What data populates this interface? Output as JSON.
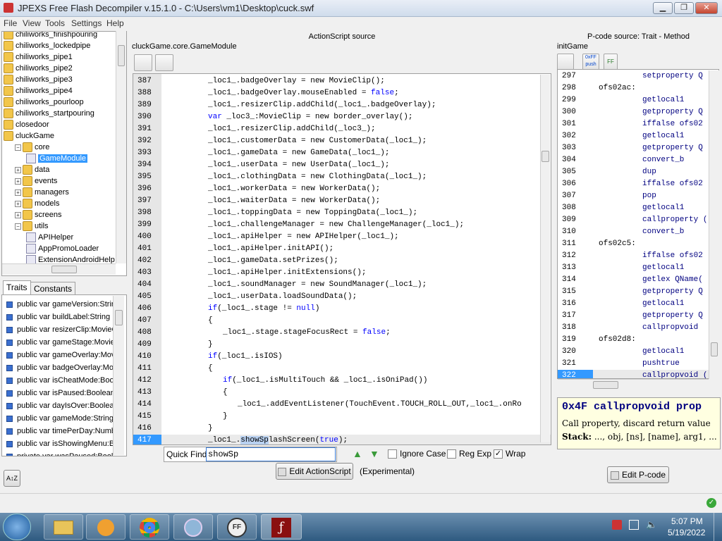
{
  "window": {
    "title": "JPEXS Free Flash Decompiler v.15.1.0 - C:\\Users\\vm1\\Desktop\\cuck.swf",
    "minimize": "▁",
    "maximize": "❐",
    "close": "✕"
  },
  "menu": [
    "File",
    "View",
    "Tools",
    "Settings",
    "Help"
  ],
  "tree": {
    "items": [
      {
        "label": "chiliworks_finishpouring",
        "type": "folder",
        "indent": 0
      },
      {
        "label": "chiliworks_lockedpipe",
        "type": "folder",
        "indent": 0
      },
      {
        "label": "chiliworks_pipe1",
        "type": "folder",
        "indent": 0
      },
      {
        "label": "chiliworks_pipe2",
        "type": "folder",
        "indent": 0
      },
      {
        "label": "chiliworks_pipe3",
        "type": "folder",
        "indent": 0
      },
      {
        "label": "chiliworks_pipe4",
        "type": "folder",
        "indent": 0
      },
      {
        "label": "chiliworks_pourloop",
        "type": "folder",
        "indent": 0
      },
      {
        "label": "chiliworks_startpouring",
        "type": "folder",
        "indent": 0
      },
      {
        "label": "closedoor",
        "type": "folder",
        "indent": 0
      },
      {
        "label": "cluckGame",
        "type": "folder",
        "indent": 0
      },
      {
        "label": "core",
        "type": "folder",
        "indent": 1,
        "toggle": "−"
      },
      {
        "label": "GameModule",
        "type": "class",
        "indent": 2,
        "selected": true
      },
      {
        "label": "data",
        "type": "folder",
        "indent": 1,
        "toggle": "+"
      },
      {
        "label": "events",
        "type": "folder",
        "indent": 1,
        "toggle": "+"
      },
      {
        "label": "managers",
        "type": "folder",
        "indent": 1,
        "toggle": "+"
      },
      {
        "label": "models",
        "type": "folder",
        "indent": 1,
        "toggle": "+"
      },
      {
        "label": "screens",
        "type": "folder",
        "indent": 1,
        "toggle": "+"
      },
      {
        "label": "utils",
        "type": "folder",
        "indent": 1,
        "toggle": "−"
      },
      {
        "label": "APIHelper",
        "type": "class",
        "indent": 2
      },
      {
        "label": "AppPromoLoader",
        "type": "class",
        "indent": 2
      },
      {
        "label": "ExtensionAndroidHelp",
        "type": "class",
        "indent": 2
      }
    ]
  },
  "traits_tabs": [
    "Traits",
    "Constants"
  ],
  "traits": [
    "public var gameVersion:Strin",
    "public var buildLabel:String",
    "public var resizerClip:MovieC",
    "public var gameStage:Movie",
    "public var gameOverlay:Mov",
    "public var badgeOverlay:Mo",
    "public var isCheatMode:Boo",
    "public var isPaused:Boolean",
    "public var dayIsOver:Boolea",
    "public var gameMode:String",
    "public var timePerDay:Numb",
    "public var isShowingMenu:B",
    "private var wasPaused:Bool"
  ],
  "sort_button": "A↕Z",
  "as_panel": {
    "header": "ActionScript source",
    "path": "cluckGame.core.GameModule",
    "lines": [
      {
        "n": "387",
        "i": 0,
        "parts": [
          [
            "_loc1_.badgeOverlay = new MovieClip();",
            ""
          ]
        ]
      },
      {
        "n": "388",
        "i": 0,
        "parts": [
          [
            "_loc1_.badgeOverlay.mouseEnabled = ",
            ""
          ],
          [
            "false",
            "kw"
          ],
          [
            ";",
            ""
          ]
        ]
      },
      {
        "n": "389",
        "i": 0,
        "parts": [
          [
            "_loc1_.resizerClip.addChild(_loc1_.badgeOverlay);",
            ""
          ]
        ]
      },
      {
        "n": "390",
        "i": 0,
        "parts": [
          [
            "var",
            "kw"
          ],
          [
            " _loc3_:MovieClip = new border_overlay();",
            ""
          ]
        ]
      },
      {
        "n": "391",
        "i": 0,
        "parts": [
          [
            "_loc1_.resizerClip.addChild(_loc3_);",
            ""
          ]
        ]
      },
      {
        "n": "392",
        "i": 0,
        "parts": [
          [
            "_loc1_.customerData = new CustomerData(_loc1_);",
            ""
          ]
        ]
      },
      {
        "n": "393",
        "i": 0,
        "parts": [
          [
            "_loc1_.gameData = new GameData(_loc1_);",
            ""
          ]
        ]
      },
      {
        "n": "394",
        "i": 0,
        "parts": [
          [
            "_loc1_.userData = new UserData(_loc1_);",
            ""
          ]
        ]
      },
      {
        "n": "395",
        "i": 0,
        "parts": [
          [
            "_loc1_.clothingData = new ClothingData(_loc1_);",
            ""
          ]
        ]
      },
      {
        "n": "396",
        "i": 0,
        "parts": [
          [
            "_loc1_.workerData = new WorkerData();",
            ""
          ]
        ]
      },
      {
        "n": "397",
        "i": 0,
        "parts": [
          [
            "_loc1_.waiterData = new WorkerData();",
            ""
          ]
        ]
      },
      {
        "n": "398",
        "i": 0,
        "parts": [
          [
            "_loc1_.toppingData = new ToppingData(_loc1_);",
            ""
          ]
        ]
      },
      {
        "n": "399",
        "i": 0,
        "parts": [
          [
            "_loc1_.challengeManager = new ChallengeManager(_loc1_);",
            ""
          ]
        ]
      },
      {
        "n": "400",
        "i": 0,
        "parts": [
          [
            "_loc1_.apiHelper = new APIHelper(_loc1_);",
            ""
          ]
        ]
      },
      {
        "n": "401",
        "i": 0,
        "parts": [
          [
            "_loc1_.apiHelper.initAPI();",
            ""
          ]
        ]
      },
      {
        "n": "402",
        "i": 0,
        "parts": [
          [
            "_loc1_.gameData.setPrizes();",
            ""
          ]
        ]
      },
      {
        "n": "403",
        "i": 0,
        "parts": [
          [
            "_loc1_.apiHelper.initExtensions();",
            ""
          ]
        ]
      },
      {
        "n": "404",
        "i": 0,
        "parts": [
          [
            "_loc1_.soundManager = new SoundManager(_loc1_);",
            ""
          ]
        ]
      },
      {
        "n": "405",
        "i": 0,
        "parts": [
          [
            "_loc1_.userData.loadSoundData();",
            ""
          ]
        ]
      },
      {
        "n": "406",
        "i": 0,
        "parts": [
          [
            "if",
            "kw"
          ],
          [
            "(_loc1_.stage != ",
            ""
          ],
          [
            "null",
            "kw"
          ],
          [
            ")",
            ""
          ]
        ]
      },
      {
        "n": "407",
        "i": 0,
        "parts": [
          [
            "{",
            ""
          ]
        ]
      },
      {
        "n": "408",
        "i": 1,
        "parts": [
          [
            "_loc1_.stage.stageFocusRect = ",
            ""
          ],
          [
            "false",
            "kw"
          ],
          [
            ";",
            ""
          ]
        ]
      },
      {
        "n": "409",
        "i": 0,
        "parts": [
          [
            "}",
            ""
          ]
        ]
      },
      {
        "n": "410",
        "i": 0,
        "parts": [
          [
            "if",
            "kw"
          ],
          [
            "(_loc1_.isIOS)",
            ""
          ]
        ]
      },
      {
        "n": "411",
        "i": 0,
        "parts": [
          [
            "{",
            ""
          ]
        ]
      },
      {
        "n": "412",
        "i": 1,
        "parts": [
          [
            "if",
            "kw"
          ],
          [
            "(_loc1_.isMultiTouch && _loc1_.isOniPad())",
            ""
          ]
        ]
      },
      {
        "n": "413",
        "i": 1,
        "parts": [
          [
            "{",
            ""
          ]
        ]
      },
      {
        "n": "414",
        "i": 2,
        "parts": [
          [
            "_loc1_.addEventListener(TouchEvent.TOUCH_ROLL_OUT,_loc1_.onRo",
            ""
          ]
        ]
      },
      {
        "n": "415",
        "i": 1,
        "parts": [
          [
            "}",
            ""
          ]
        ]
      },
      {
        "n": "416",
        "i": 0,
        "parts": [
          [
            "}",
            ""
          ]
        ]
      },
      {
        "n": "417",
        "i": 0,
        "parts": [
          [
            "_loc1_.",
            ""
          ],
          [
            "showSp",
            "hl"
          ],
          [
            "lashScreen(",
            ""
          ],
          [
            "true",
            "kw"
          ],
          [
            ");",
            ""
          ]
        ],
        "current": true
      }
    ],
    "quick_find_label": "Quick Find",
    "quick_find_value": "showSp",
    "ignore_case": "Ignore Case",
    "reg_exp": "Reg Exp",
    "wrap": "Wrap",
    "wrap_checked": true,
    "edit_button": "Edit ActionScript",
    "experimental": "(Experimental)"
  },
  "pcode_panel": {
    "header": "P-code source: Trait - Method",
    "path": "initGame",
    "toolbar": [
      {
        "label": "push",
        "icon": "0xFF"
      },
      {
        "label": "FF",
        "icon": "FF"
      }
    ],
    "lines": [
      {
        "n": "297",
        "label": "",
        "ins": "setproperty Q"
      },
      {
        "n": "298",
        "label": "ofs02ac:",
        "ins": ""
      },
      {
        "n": "299",
        "label": "",
        "ins": "getlocal1"
      },
      {
        "n": "300",
        "label": "",
        "ins": "getproperty Q"
      },
      {
        "n": "301",
        "label": "",
        "ins": "iffalse ofs02"
      },
      {
        "n": "302",
        "label": "",
        "ins": "getlocal1"
      },
      {
        "n": "303",
        "label": "",
        "ins": "getproperty Q"
      },
      {
        "n": "304",
        "label": "",
        "ins": "convert_b"
      },
      {
        "n": "305",
        "label": "",
        "ins": "dup"
      },
      {
        "n": "306",
        "label": "",
        "ins": "iffalse ofs02"
      },
      {
        "n": "307",
        "label": "",
        "ins": "pop"
      },
      {
        "n": "308",
        "label": "",
        "ins": "getlocal1"
      },
      {
        "n": "309",
        "label": "",
        "ins": "callproperty ("
      },
      {
        "n": "310",
        "label": "",
        "ins": "convert_b"
      },
      {
        "n": "311",
        "label": "ofs02c5:",
        "ins": ""
      },
      {
        "n": "312",
        "label": "",
        "ins": "iffalse ofs02"
      },
      {
        "n": "313",
        "label": "",
        "ins": "getlocal1"
      },
      {
        "n": "314",
        "label": "",
        "ins": "getlex QName("
      },
      {
        "n": "315",
        "label": "",
        "ins": "getproperty Q"
      },
      {
        "n": "316",
        "label": "",
        "ins": "getlocal1"
      },
      {
        "n": "317",
        "label": "",
        "ins": "getproperty Q"
      },
      {
        "n": "318",
        "label": "",
        "ins": "callpropvoid"
      },
      {
        "n": "319",
        "label": "ofs02d8:",
        "ins": ""
      },
      {
        "n": "320",
        "label": "",
        "ins": "getlocal1"
      },
      {
        "n": "321",
        "label": "",
        "ins": "pushtrue"
      },
      {
        "n": "322",
        "label": "",
        "ins": "callpropvoid (",
        "current": true
      }
    ],
    "doc_title": "0x4F callpropvoid prop",
    "doc_desc": "Call property, discard return value",
    "doc_stack_label": "Stack:",
    "doc_stack": " ..., obj, [ns], [name], arg1, ...",
    "edit_button": "Edit P-code"
  },
  "taskbar": {
    "time": "5:07 PM",
    "date": "5/19/2022",
    "apps": [
      "start-orb",
      "explorer",
      "media-player",
      "chrome",
      "network-app",
      "ffdec",
      "flash-player"
    ]
  }
}
